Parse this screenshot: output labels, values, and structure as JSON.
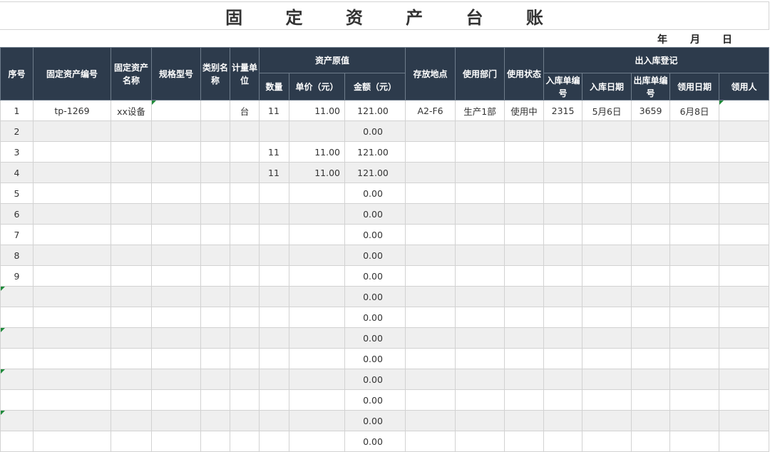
{
  "title": "固 定 资 产 台 账",
  "date": {
    "year": "年",
    "month": "月",
    "day": "日"
  },
  "headers": {
    "index": "序号",
    "asset_code": "固定资产编号",
    "asset_name": "固定资产名称",
    "spec": "规格型号",
    "category": "类别名称",
    "unit": "计量单位",
    "original_value": "资产原值",
    "qty": "数量",
    "unit_price": "单价（元）",
    "amount": "金额（元）",
    "location": "存放地点",
    "department": "使用部门",
    "status": "使用状态",
    "inout": "出入库登记",
    "in_no": "入库单编号",
    "in_date": "入库日期",
    "out_no": "出库单编号",
    "receive_date": "领用日期",
    "receiver": "领用人"
  },
  "rows": [
    {
      "idx": "1",
      "code": "tp-1269",
      "name": "xx设备",
      "spec": "",
      "cat": "",
      "unit": "台",
      "qty": "11",
      "price": "11.00",
      "amount": "121.00",
      "loc": "A2-F6",
      "dept": "生产1部",
      "status": "使用中",
      "in_no": "2315",
      "in_date": "5月6日",
      "out_no": "3659",
      "recv_date": "6月8日",
      "receiver": ""
    },
    {
      "idx": "2",
      "code": "",
      "name": "",
      "spec": "",
      "cat": "",
      "unit": "",
      "qty": "",
      "price": "",
      "amount": "0.00",
      "loc": "",
      "dept": "",
      "status": "",
      "in_no": "",
      "in_date": "",
      "out_no": "",
      "recv_date": "",
      "receiver": ""
    },
    {
      "idx": "3",
      "code": "",
      "name": "",
      "spec": "",
      "cat": "",
      "unit": "",
      "qty": "11",
      "price": "11.00",
      "amount": "121.00",
      "loc": "",
      "dept": "",
      "status": "",
      "in_no": "",
      "in_date": "",
      "out_no": "",
      "recv_date": "",
      "receiver": ""
    },
    {
      "idx": "4",
      "code": "",
      "name": "",
      "spec": "",
      "cat": "",
      "unit": "",
      "qty": "11",
      "price": "11.00",
      "amount": "121.00",
      "loc": "",
      "dept": "",
      "status": "",
      "in_no": "",
      "in_date": "",
      "out_no": "",
      "recv_date": "",
      "receiver": ""
    },
    {
      "idx": "5",
      "code": "",
      "name": "",
      "spec": "",
      "cat": "",
      "unit": "",
      "qty": "",
      "price": "",
      "amount": "0.00",
      "loc": "",
      "dept": "",
      "status": "",
      "in_no": "",
      "in_date": "",
      "out_no": "",
      "recv_date": "",
      "receiver": ""
    },
    {
      "idx": "6",
      "code": "",
      "name": "",
      "spec": "",
      "cat": "",
      "unit": "",
      "qty": "",
      "price": "",
      "amount": "0.00",
      "loc": "",
      "dept": "",
      "status": "",
      "in_no": "",
      "in_date": "",
      "out_no": "",
      "recv_date": "",
      "receiver": ""
    },
    {
      "idx": "7",
      "code": "",
      "name": "",
      "spec": "",
      "cat": "",
      "unit": "",
      "qty": "",
      "price": "",
      "amount": "0.00",
      "loc": "",
      "dept": "",
      "status": "",
      "in_no": "",
      "in_date": "",
      "out_no": "",
      "recv_date": "",
      "receiver": ""
    },
    {
      "idx": "8",
      "code": "",
      "name": "",
      "spec": "",
      "cat": "",
      "unit": "",
      "qty": "",
      "price": "",
      "amount": "0.00",
      "loc": "",
      "dept": "",
      "status": "",
      "in_no": "",
      "in_date": "",
      "out_no": "",
      "recv_date": "",
      "receiver": ""
    },
    {
      "idx": "9",
      "code": "",
      "name": "",
      "spec": "",
      "cat": "",
      "unit": "",
      "qty": "",
      "price": "",
      "amount": "0.00",
      "loc": "",
      "dept": "",
      "status": "",
      "in_no": "",
      "in_date": "",
      "out_no": "",
      "recv_date": "",
      "receiver": ""
    },
    {
      "idx": "",
      "code": "",
      "name": "",
      "spec": "",
      "cat": "",
      "unit": "",
      "qty": "",
      "price": "",
      "amount": "0.00",
      "loc": "",
      "dept": "",
      "status": "",
      "in_no": "",
      "in_date": "",
      "out_no": "",
      "recv_date": "",
      "receiver": ""
    },
    {
      "idx": "",
      "code": "",
      "name": "",
      "spec": "",
      "cat": "",
      "unit": "",
      "qty": "",
      "price": "",
      "amount": "0.00",
      "loc": "",
      "dept": "",
      "status": "",
      "in_no": "",
      "in_date": "",
      "out_no": "",
      "recv_date": "",
      "receiver": ""
    },
    {
      "idx": "",
      "code": "",
      "name": "",
      "spec": "",
      "cat": "",
      "unit": "",
      "qty": "",
      "price": "",
      "amount": "0.00",
      "loc": "",
      "dept": "",
      "status": "",
      "in_no": "",
      "in_date": "",
      "out_no": "",
      "recv_date": "",
      "receiver": ""
    },
    {
      "idx": "",
      "code": "",
      "name": "",
      "spec": "",
      "cat": "",
      "unit": "",
      "qty": "",
      "price": "",
      "amount": "0.00",
      "loc": "",
      "dept": "",
      "status": "",
      "in_no": "",
      "in_date": "",
      "out_no": "",
      "recv_date": "",
      "receiver": ""
    },
    {
      "idx": "",
      "code": "",
      "name": "",
      "spec": "",
      "cat": "",
      "unit": "",
      "qty": "",
      "price": "",
      "amount": "0.00",
      "loc": "",
      "dept": "",
      "status": "",
      "in_no": "",
      "in_date": "",
      "out_no": "",
      "recv_date": "",
      "receiver": ""
    },
    {
      "idx": "",
      "code": "",
      "name": "",
      "spec": "",
      "cat": "",
      "unit": "",
      "qty": "",
      "price": "",
      "amount": "0.00",
      "loc": "",
      "dept": "",
      "status": "",
      "in_no": "",
      "in_date": "",
      "out_no": "",
      "recv_date": "",
      "receiver": ""
    },
    {
      "idx": "",
      "code": "",
      "name": "",
      "spec": "",
      "cat": "",
      "unit": "",
      "qty": "",
      "price": "",
      "amount": "0.00",
      "loc": "",
      "dept": "",
      "status": "",
      "in_no": "",
      "in_date": "",
      "out_no": "",
      "recv_date": "",
      "receiver": ""
    },
    {
      "idx": "",
      "code": "",
      "name": "",
      "spec": "",
      "cat": "",
      "unit": "",
      "qty": "",
      "price": "",
      "amount": "0.00",
      "loc": "",
      "dept": "",
      "status": "",
      "in_no": "",
      "in_date": "",
      "out_no": "",
      "recv_date": "",
      "receiver": ""
    }
  ],
  "colors": {
    "header_bg": "#2d3b4c",
    "stripe": "#efefef",
    "error_marker": "#1f8a3a"
  }
}
